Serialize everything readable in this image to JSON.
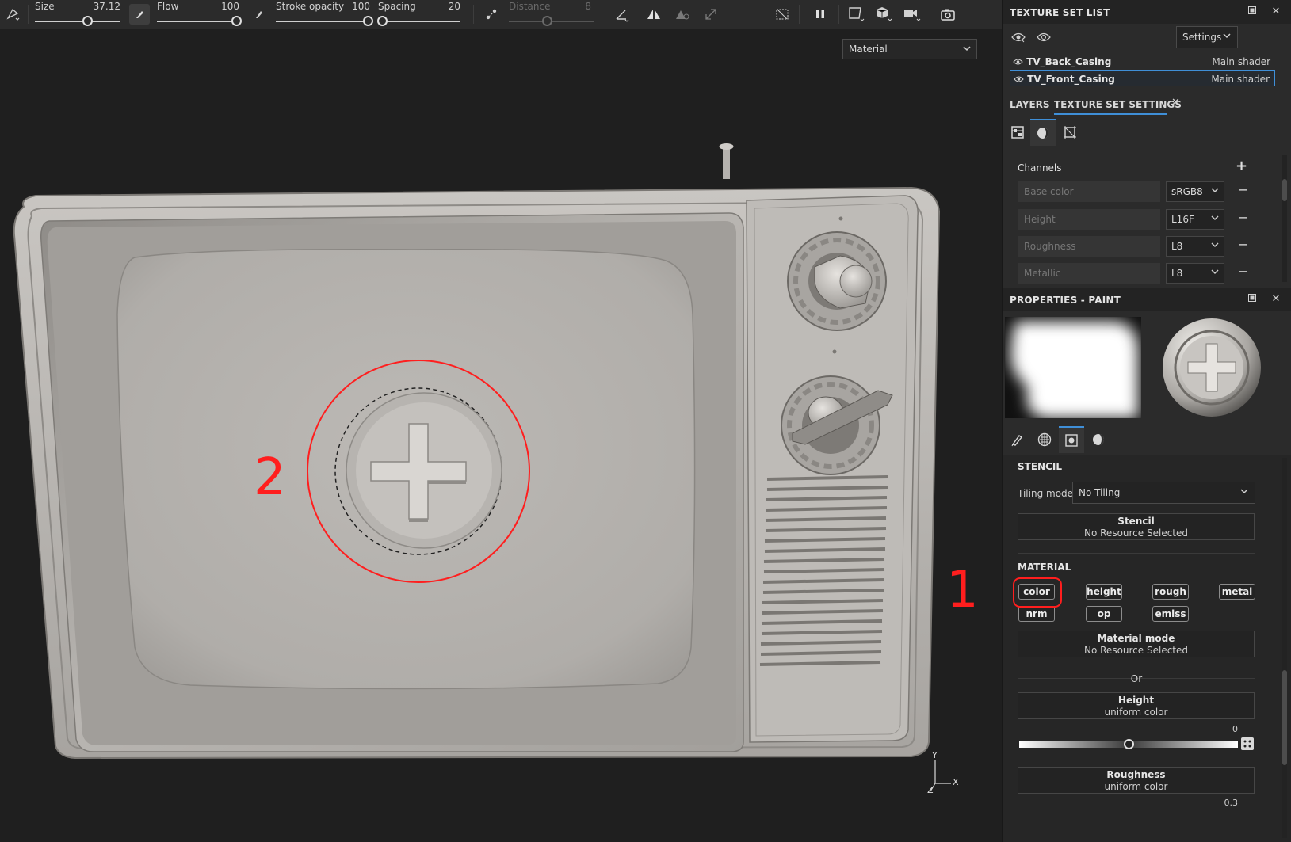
{
  "toolbar": {
    "size_label": "Size",
    "size_value": "37.12",
    "flow_label": "Flow",
    "flow_value": "100",
    "stroke_opacity_label": "Stroke opacity",
    "stroke_opacity_value": "100",
    "spacing_label": "Spacing",
    "spacing_value": "20",
    "distance_label": "Distance",
    "distance_value": "8",
    "size_level": 0.62,
    "flow_level": 1.0,
    "stroke_opacity_level": 1.0,
    "spacing_level": 0.05,
    "distance_level": 0.45
  },
  "viewport": {
    "display_mode": "Material",
    "annotation_1": "1",
    "annotation_2": "2",
    "axis_y": "Y",
    "axis_x": "X",
    "axis_z": "Z"
  },
  "texture_set_list": {
    "title": "TEXTURE SET LIST",
    "settings_label": "Settings",
    "items": [
      {
        "name": "TV_Back_Casing",
        "shader": "Main shader",
        "selected": false
      },
      {
        "name": "TV_Front_Casing",
        "shader": "Main shader",
        "selected": true
      }
    ]
  },
  "tabs": {
    "layers": "LAYERS",
    "texture_set_settings": "TEXTURE SET SETTINGS"
  },
  "channels": {
    "title": "Channels",
    "items": [
      {
        "name": "Base color",
        "format": "sRGB8"
      },
      {
        "name": "Height",
        "format": "L16F"
      },
      {
        "name": "Roughness",
        "format": "L8"
      },
      {
        "name": "Metallic",
        "format": "L8"
      }
    ]
  },
  "properties": {
    "title": "PROPERTIES - PAINT",
    "stencil_title": "STENCIL",
    "tiling_mode_label": "Tiling mode",
    "tiling_mode_value": "No Tiling",
    "stencil_box_title": "Stencil",
    "stencil_box_sub": "No Resource Selected",
    "material_title": "MATERIAL",
    "chips": {
      "color": "color",
      "height": "height",
      "rough": "rough",
      "metal": "metal",
      "nrm": "nrm",
      "op": "op",
      "emiss": "emiss"
    },
    "material_mode_title": "Material mode",
    "material_mode_sub": "No Resource Selected",
    "or_label": "Or",
    "height_title": "Height",
    "height_sub": "uniform color",
    "height_value": "0",
    "height_level": 0.5,
    "roughness_title": "Roughness",
    "roughness_sub": "uniform color",
    "roughness_value": "0.3"
  },
  "colors": {
    "accent": "#3f8fd8",
    "annotation": "#ff1e1e",
    "panel_bg": "#2b2b2b",
    "viewport_bg": "#1f1f1f"
  }
}
